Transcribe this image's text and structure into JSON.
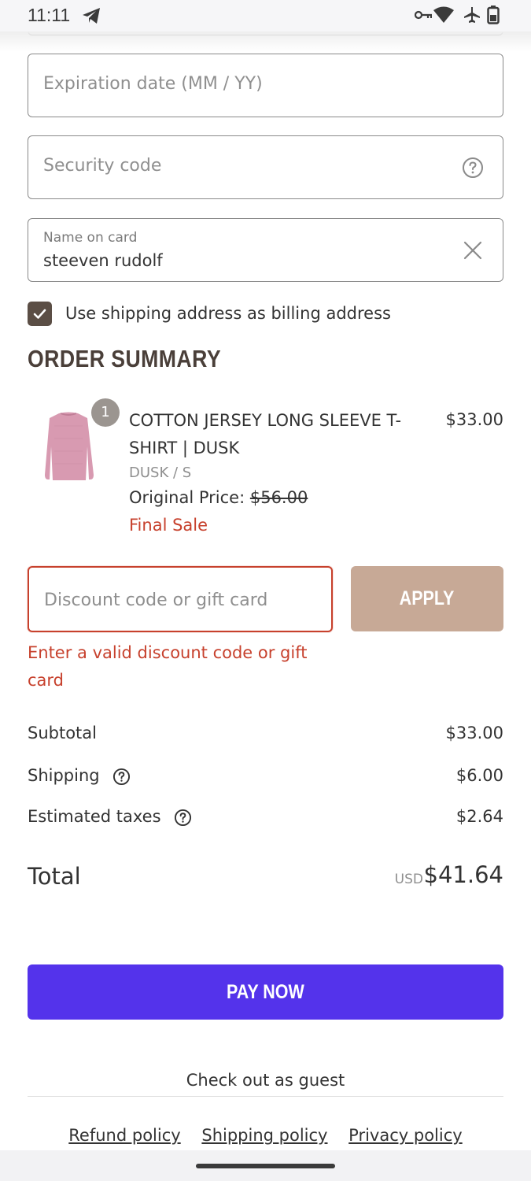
{
  "status_bar": {
    "time": "11:11"
  },
  "payment": {
    "expiration_placeholder": "Expiration date (MM / YY)",
    "security_placeholder": "Security code",
    "name_label": "Name on card",
    "name_value": "steeven rudolf",
    "billing_checkbox_label": "Use shipping address as billing address",
    "billing_checked": true
  },
  "order_summary": {
    "title": "ORDER SUMMARY",
    "item": {
      "quantity": "1",
      "name": "COTTON JERSEY LONG SLEEVE T-SHIRT | DUSK",
      "price": "$33.00",
      "variant": "DUSK / S",
      "original_price_label": "Original Price:",
      "original_price_value": "$56.00",
      "final_sale": "Final Sale"
    },
    "discount": {
      "placeholder": "Discount code or gift card",
      "apply_label": "APPLY",
      "error": "Enter a valid discount code or gift card"
    },
    "subtotal_label": "Subtotal",
    "subtotal_value": "$33.00",
    "shipping_label": "Shipping",
    "shipping_value": "$6.00",
    "taxes_label": "Estimated taxes",
    "taxes_value": "$2.64",
    "total_label": "Total",
    "total_currency": "USD",
    "total_value": "$41.64"
  },
  "actions": {
    "pay_now": "PAY NOW",
    "guest_checkout": "Check out as guest"
  },
  "footer": {
    "refund": "Refund policy",
    "shipping": "Shipping policy",
    "privacy": "Privacy policy"
  },
  "colors": {
    "accent_pay": "#5433eb",
    "apply_button": "#c7a996",
    "error": "#c7412d",
    "heading": "#4a3f39"
  },
  "icons": [
    "telegram-icon",
    "vpn-key-icon",
    "wifi-icon",
    "airplane-icon",
    "battery-icon",
    "help-circle-icon",
    "clear-icon",
    "checkmark-icon"
  ]
}
